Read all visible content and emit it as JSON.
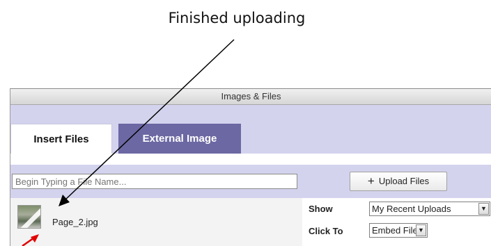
{
  "annotation": {
    "caption": "Finished uploading"
  },
  "window": {
    "title": "Images & Files"
  },
  "tabs": [
    {
      "label": "Insert Files"
    },
    {
      "label": "External Image"
    }
  ],
  "search": {
    "placeholder": "Begin Typing a File Name..."
  },
  "upload": {
    "icon": "plus-icon",
    "label": "Upload Files"
  },
  "files": [
    {
      "name": "Page_2.jpg",
      "thumbnail": "image-thumbnail"
    }
  ],
  "options": {
    "show_label": "Show",
    "show_value": "My Recent Uploads",
    "click_label": "Click To",
    "click_value": "Embed File"
  },
  "colors": {
    "tab_band": "#d3d3ee",
    "active_tab": "#6c68a3",
    "annotation_black": "#000000",
    "annotation_red": "#e00000"
  }
}
